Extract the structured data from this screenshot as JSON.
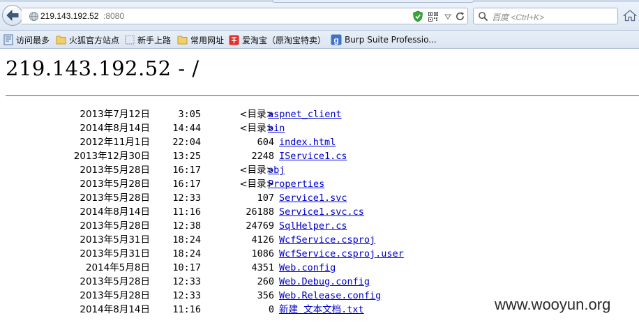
{
  "browser": {
    "url_host": "219.143.192.52",
    "url_port": ":8080",
    "search_placeholder": "百度 <Ctrl+K>"
  },
  "bookmarks": [
    {
      "label": "访问最多",
      "icon": "bookmark-page-icon"
    },
    {
      "label": "火狐官方站点",
      "icon": "folder-icon"
    },
    {
      "label": "新手上路",
      "icon": "dotted-box-icon"
    },
    {
      "label": "常用网址",
      "icon": "folder-icon"
    },
    {
      "label": "爱淘宝（原淘宝特卖）",
      "icon": "taobao-icon"
    },
    {
      "label": "Burp Suite Professio...",
      "icon": "google-icon"
    }
  ],
  "page": {
    "title": "219.143.192.52 - /",
    "dir_label": "<目录>"
  },
  "listing": [
    {
      "date": "2013年7月12日",
      "time": "3:05",
      "size": "<目录>",
      "name": "aspnet_client",
      "is_dir": true
    },
    {
      "date": "2014年8月14日",
      "time": "14:44",
      "size": "<目录>",
      "name": "bin",
      "is_dir": true
    },
    {
      "date": "2012年11月1日",
      "time": "22:04",
      "size": "604",
      "name": "index.html",
      "is_dir": false
    },
    {
      "date": "2013年12月30日",
      "time": "13:25",
      "size": "2248",
      "name": "IService1.cs",
      "is_dir": false
    },
    {
      "date": "2013年5月28日",
      "time": "16:17",
      "size": "<目录>",
      "name": "obj",
      "is_dir": true
    },
    {
      "date": "2013年5月28日",
      "time": "16:17",
      "size": "<目录>",
      "name": "Properties",
      "is_dir": true
    },
    {
      "date": "2013年5月28日",
      "time": "12:33",
      "size": "107",
      "name": "Service1.svc",
      "is_dir": false
    },
    {
      "date": "2014年8月14日",
      "time": "11:16",
      "size": "26188",
      "name": "Service1.svc.cs",
      "is_dir": false
    },
    {
      "date": "2013年5月28日",
      "time": "12:38",
      "size": "24769",
      "name": "SqlHelper.cs",
      "is_dir": false
    },
    {
      "date": "2013年5月31日",
      "time": "18:24",
      "size": "4126",
      "name": "WcfService.csproj",
      "is_dir": false
    },
    {
      "date": "2013年5月31日",
      "time": "18:24",
      "size": "1086",
      "name": "WcfService.csproj.user",
      "is_dir": false
    },
    {
      "date": "2014年5月8日",
      "time": "10:17",
      "size": "4351",
      "name": "Web.config",
      "is_dir": false
    },
    {
      "date": "2013年5月28日",
      "time": "12:33",
      "size": "260",
      "name": "Web.Debug.config",
      "is_dir": false
    },
    {
      "date": "2013年5月28日",
      "time": "12:33",
      "size": "356",
      "name": "Web.Release.config",
      "is_dir": false
    },
    {
      "date": "2014年8月14日",
      "time": "11:16",
      "size": "0",
      "name": "新建 文本文档.txt",
      "is_dir": false
    }
  ],
  "watermark": "www.wooyun.org",
  "colors": {
    "link": "#0000cc",
    "shield_green": "#3aa53a",
    "taobao_red": "#e0302a"
  }
}
